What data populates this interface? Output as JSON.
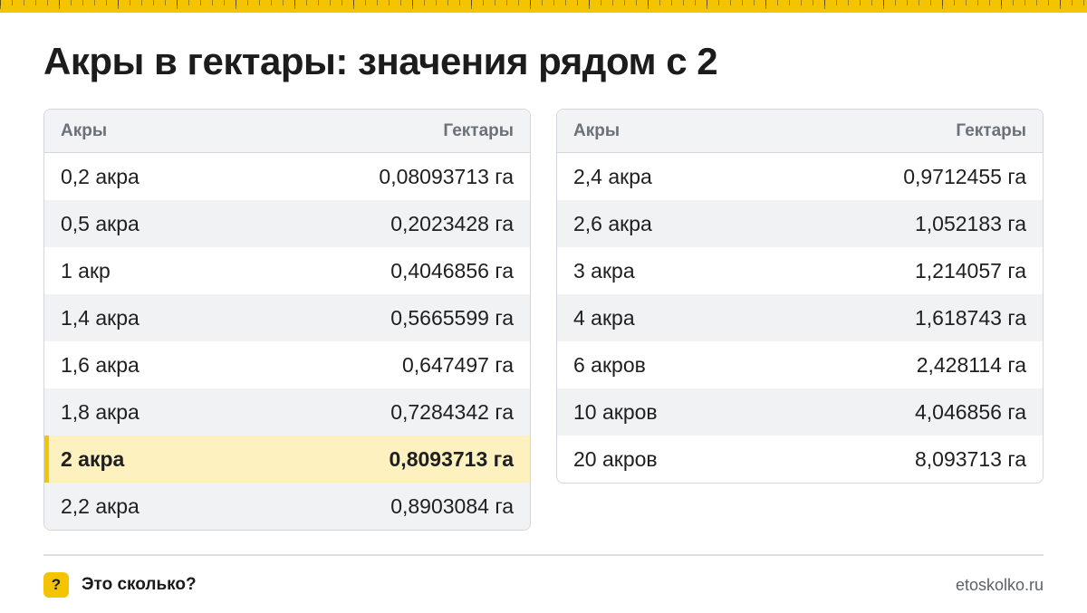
{
  "title": "Акры в гектары: значения рядом с 2",
  "left_table": {
    "header": {
      "col1": "Акры",
      "col2": "Гектары"
    },
    "rows": [
      {
        "a": "0,2 акра",
        "h": "0,08093713 га"
      },
      {
        "a": "0,5 акра",
        "h": "0,2023428 га"
      },
      {
        "a": "1 акр",
        "h": "0,4046856 га"
      },
      {
        "a": "1,4 акра",
        "h": "0,5665599 га"
      },
      {
        "a": "1,6 акра",
        "h": "0,647497 га"
      },
      {
        "a": "1,8 акра",
        "h": "0,7284342 га"
      },
      {
        "a": "2 акра",
        "h": "0,8093713 га"
      },
      {
        "a": "2,2 акра",
        "h": "0,8903084 га"
      }
    ]
  },
  "right_table": {
    "header": {
      "col1": "Акры",
      "col2": "Гектары"
    },
    "rows": [
      {
        "a": "2,4 акра",
        "h": "0,9712455 га"
      },
      {
        "a": "2,6 акра",
        "h": "1,052183 га"
      },
      {
        "a": "3 акра",
        "h": "1,214057 га"
      },
      {
        "a": "4 акра",
        "h": "1,618743 га"
      },
      {
        "a": "6 акров",
        "h": "2,428114 га"
      },
      {
        "a": "10 акров",
        "h": "4,046856 га"
      },
      {
        "a": "20 акров",
        "h": "8,093713 га"
      }
    ]
  },
  "footer": {
    "icon_glyph": "?",
    "icon": "question-icon",
    "brand": "Это сколько?",
    "site": "etoskolko.ru"
  },
  "colors": {
    "accent": "#f5c400",
    "highlight_row": "#fdf1bf"
  }
}
